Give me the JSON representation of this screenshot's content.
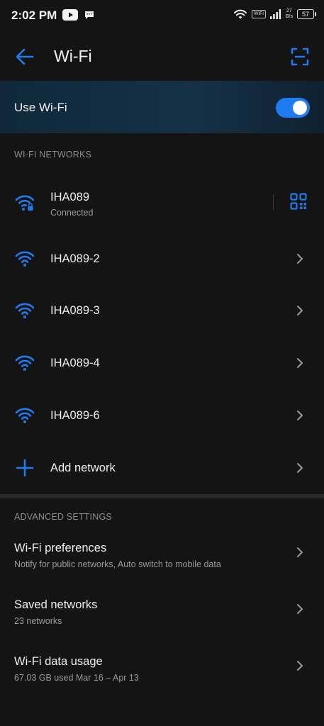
{
  "status_bar": {
    "time": "2:02 PM",
    "wifi_chip": "WiFi",
    "net_speed_value": "27",
    "net_speed_unit": "B/s",
    "battery": "57"
  },
  "app_bar": {
    "title": "Wi-Fi"
  },
  "toggle": {
    "label": "Use Wi-Fi",
    "enabled": true
  },
  "sections": {
    "networks_header": "WI-FI NETWORKS",
    "advanced_header": "ADVANCED SETTINGS"
  },
  "networks": [
    {
      "name": "IHA089",
      "status": "Connected"
    },
    {
      "name": "IHA089-2"
    },
    {
      "name": "IHA089-3"
    },
    {
      "name": "IHA089-4"
    },
    {
      "name": "IHA089-6"
    }
  ],
  "add_network": {
    "label": "Add network"
  },
  "advanced": [
    {
      "title": "Wi-Fi preferences",
      "subtitle": "Notify for public networks, Auto switch to mobile data"
    },
    {
      "title": "Saved networks",
      "subtitle": "23 networks"
    },
    {
      "title": "Wi-Fi data usage",
      "subtitle": "67.03 GB used Mar 16 – Apr 13"
    }
  ],
  "colors": {
    "accent": "#1f7cf0",
    "background": "#141414",
    "toggle_row": "#153146"
  },
  "icons": {
    "back": "arrow-left-icon",
    "scan": "scan-icon",
    "wifi": "wifi-icon",
    "qr": "qr-code-icon",
    "add": "plus-icon",
    "chevron": "chevron-right-icon"
  }
}
